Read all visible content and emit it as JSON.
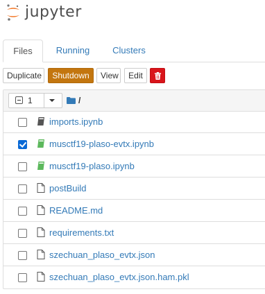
{
  "header": {
    "logo_text": "jupyter",
    "colors": {
      "logo_orange": "#f37726",
      "logo_text": "#4e4e4e"
    }
  },
  "tabs": [
    {
      "label": "Files",
      "active": true
    },
    {
      "label": "Running",
      "active": false
    },
    {
      "label": "Clusters",
      "active": false
    }
  ],
  "toolbar": {
    "duplicate_label": "Duplicate",
    "shutdown_label": "Shutdown",
    "view_label": "View",
    "edit_label": "Edit",
    "delete_icon": "trash-icon",
    "colors": {
      "shutdown": "#c3760f",
      "delete": "#d9151b"
    }
  },
  "list_header": {
    "selected_count": "1",
    "breadcrumb_icon": "folder-icon",
    "breadcrumb_path": "/"
  },
  "files": [
    {
      "name": "imports.ipynb",
      "icon": "notebook-icon",
      "status": "idle",
      "checked": false
    },
    {
      "name": "musctf19-plaso-evtx.ipynb",
      "icon": "notebook-icon",
      "status": "running",
      "checked": true
    },
    {
      "name": "musctf19-plaso.ipynb",
      "icon": "notebook-icon",
      "status": "running",
      "checked": false
    },
    {
      "name": "postBuild",
      "icon": "file-icon",
      "status": "",
      "checked": false
    },
    {
      "name": "README.md",
      "icon": "file-icon",
      "status": "",
      "checked": false
    },
    {
      "name": "requirements.txt",
      "icon": "file-icon",
      "status": "",
      "checked": false
    },
    {
      "name": "szechuan_plaso_evtx.json",
      "icon": "file-icon",
      "status": "",
      "checked": false
    },
    {
      "name": "szechuan_plaso_evtx.json.ham.pkl",
      "icon": "file-icon",
      "status": "",
      "checked": false
    }
  ],
  "colors": {
    "link": "#337ab7",
    "running_notebook": "#5cb85c",
    "checkbox_checked": "#0a6ad6"
  }
}
